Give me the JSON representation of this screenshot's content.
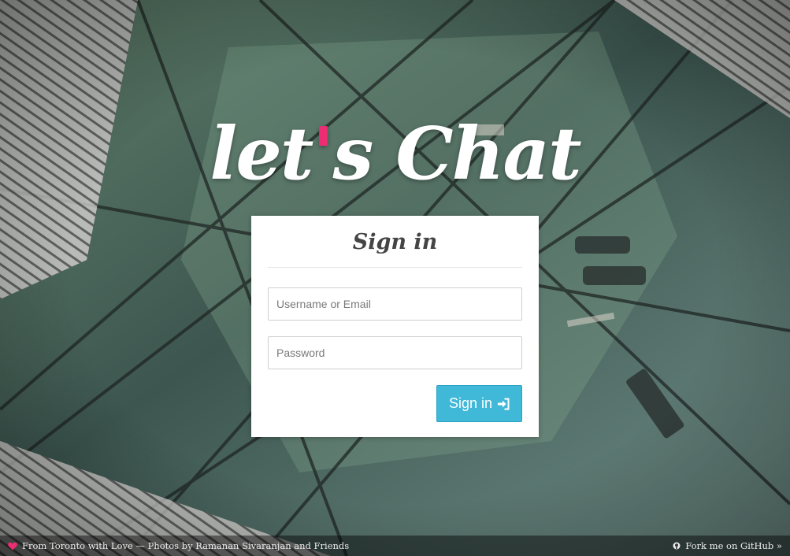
{
  "brand": {
    "logo_part1": "let",
    "logo_apostrophe": "'",
    "logo_part2": "s Chat",
    "accent_color": "#ec2d73"
  },
  "signin": {
    "title": "Sign in",
    "username_placeholder": "Username or Email",
    "username_value": "",
    "password_placeholder": "Password",
    "password_value": "",
    "submit_label": "Sign in",
    "submit_icon": "sign-in-icon",
    "button_color": "#40b8d8"
  },
  "footer": {
    "credit_icon": "heart-icon",
    "credit_text": "From Toronto with Love — Photos by Ramanan Sivaranjan and Friends",
    "github_icon": "github-icon",
    "github_text": "Fork me on GitHub »"
  }
}
